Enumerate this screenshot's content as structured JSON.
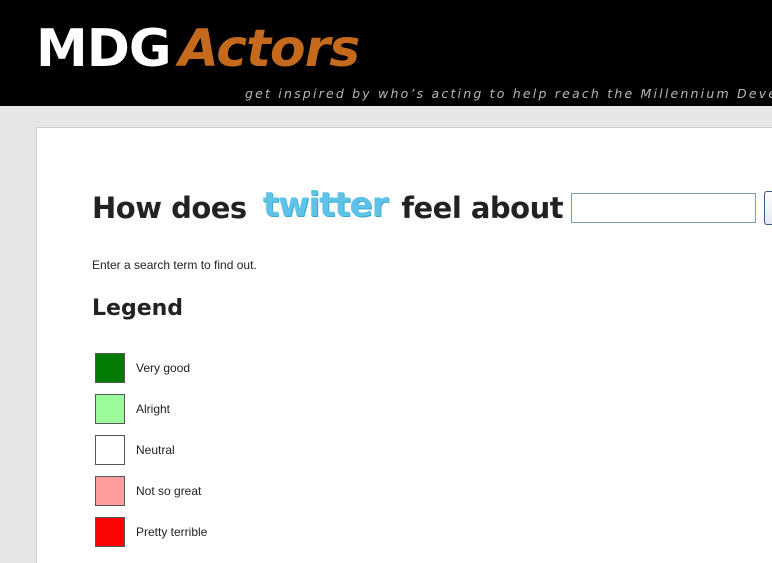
{
  "header": {
    "logo_part1": "MDG",
    "logo_part2": "Actors",
    "tagline": "get inspired by who’s acting to help reach the Millennium Developme"
  },
  "question": {
    "prefix": "How does",
    "brand": "twitter",
    "suffix": "feel about",
    "search_value": "",
    "search_placeholder": "",
    "help_label": "?"
  },
  "hint": "Enter a search term to find out.",
  "legend": {
    "title": "Legend",
    "items": [
      {
        "label": "Very good",
        "color": "#047c04"
      },
      {
        "label": "Alright",
        "color": "#9cfc9c"
      },
      {
        "label": "Neutral",
        "color": "#ffffff"
      },
      {
        "label": "Not so great",
        "color": "#fc9c9c"
      },
      {
        "label": "Pretty terrible",
        "color": "#fc0404"
      }
    ]
  },
  "colors": {
    "header_bg": "#000000",
    "logo_accent": "#c56a1c",
    "twitter_blue": "#5fc3e8"
  }
}
